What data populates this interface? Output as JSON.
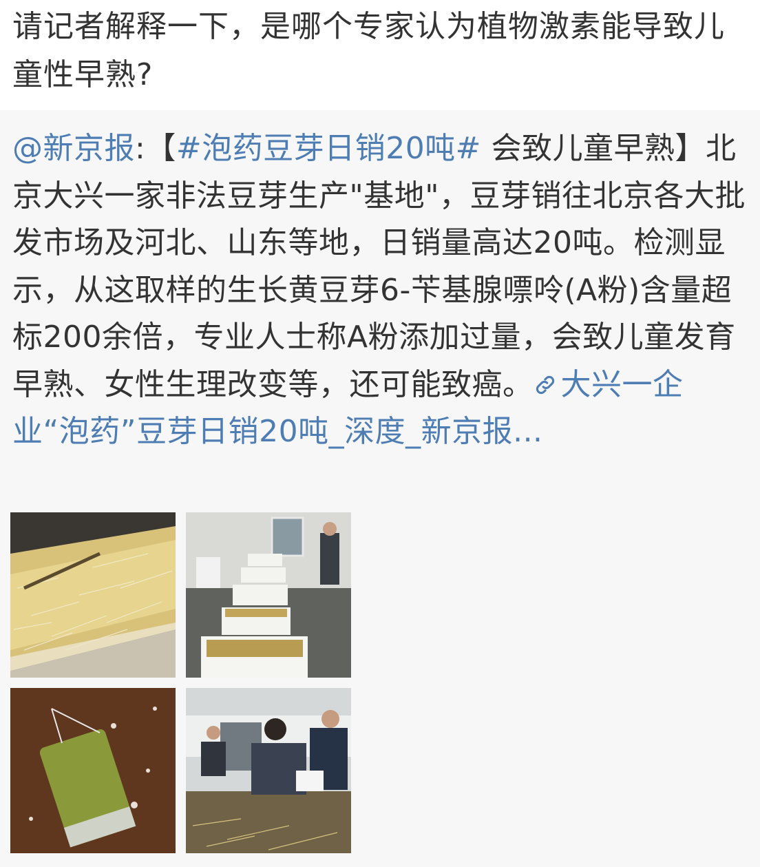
{
  "comment": {
    "text": "请记者解释一下，是哪个专家认为植物激素能导致儿童性早熟?"
  },
  "repost": {
    "author": "@新京报",
    "colon": ":",
    "bracket_open": "【",
    "hashtag": "#泡药豆芽日销20吨#",
    "body_after_hashtag": " 会致儿童早熟】北京大兴一家非法豆芽生产\"基地\"，豆芽销往北京各大批发市场及河北、山东等地，日销量高达20吨。检测显示，从这取样的生长黄豆芽6-苄基腺嘌呤(A粉)含量超标200余倍，专业人士称A粉添加过量，会致儿童发育早熟、女性生理改变等，还可能致癌。",
    "link_icon": "link-icon",
    "link_text": "大兴一企业“泡药”豆芽日销20吨_深度_新京报..."
  },
  "images": [
    {
      "icon": "bean-sprouts-photo"
    },
    {
      "icon": "soaking-tubs-photo"
    },
    {
      "icon": "mung-bean-bag-photo"
    },
    {
      "icon": "inspectors-photo"
    }
  ],
  "colors": {
    "link": "#4e7db3",
    "text": "#333333",
    "repost_background": "#f7f7f7"
  }
}
